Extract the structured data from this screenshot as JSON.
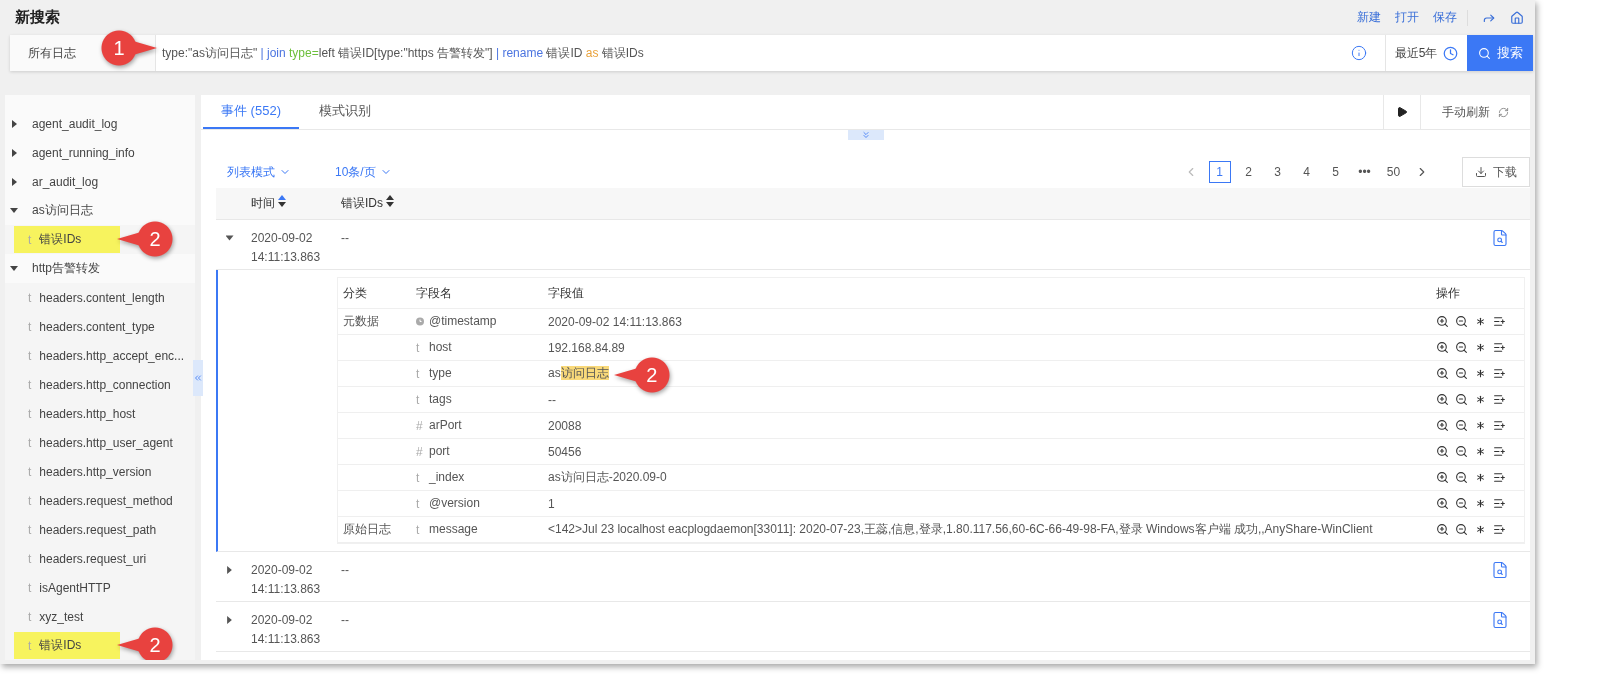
{
  "header": {
    "title": "新搜索",
    "actions": [
      "新建",
      "打开",
      "保存"
    ]
  },
  "search": {
    "scope": "所有日志",
    "callout": "1",
    "query": [
      {
        "text": "type:\"as访问日志\" ",
        "kind": "plain"
      },
      {
        "text": "| join",
        "kind": "keyword"
      },
      {
        "text": " type=",
        "kind": "param"
      },
      {
        "text": "left 错误ID[type:\"https 告警转发\"] ",
        "kind": "plain"
      },
      {
        "text": "| rename",
        "kind": "keyword"
      },
      {
        "text": " 错误ID ",
        "kind": "plain"
      },
      {
        "text": "as",
        "kind": "operator"
      },
      {
        "text": " 错误IDs",
        "kind": "plain"
      }
    ],
    "time_range": "最近5年",
    "button": "搜索"
  },
  "sidebar": {
    "items": [
      {
        "label": "agent_audit_log",
        "expanded": false
      },
      {
        "label": "agent_running_info",
        "expanded": false
      },
      {
        "label": "ar_audit_log",
        "expanded": false
      },
      {
        "label": "as访问日志",
        "expanded": true,
        "children": [
          {
            "glyph": "t",
            "label": "错误IDs",
            "highlighted": true,
            "callout": "2"
          }
        ]
      },
      {
        "label": "http告警转发",
        "expanded": true,
        "children": [
          {
            "glyph": "t",
            "label": "headers.content_length",
            "highlighted": false
          },
          {
            "glyph": "t",
            "label": "headers.content_type",
            "highlighted": false
          },
          {
            "glyph": "t",
            "label": "headers.http_accept_enc...",
            "highlighted": false
          },
          {
            "glyph": "t",
            "label": "headers.http_connection",
            "highlighted": false
          },
          {
            "glyph": "t",
            "label": "headers.http_host",
            "highlighted": false
          },
          {
            "glyph": "t",
            "label": "headers.http_user_agent",
            "highlighted": false
          },
          {
            "glyph": "t",
            "label": "headers.http_version",
            "highlighted": false
          },
          {
            "glyph": "t",
            "label": "headers.request_method",
            "highlighted": false
          },
          {
            "glyph": "t",
            "label": "headers.request_path",
            "highlighted": false
          },
          {
            "glyph": "t",
            "label": "headers.request_uri",
            "highlighted": false
          },
          {
            "glyph": "t",
            "label": "isAgentHTTP",
            "highlighted": false
          },
          {
            "glyph": "t",
            "label": "xyz_test",
            "highlighted": false
          },
          {
            "glyph": "t",
            "label": "错误IDs",
            "highlighted": true,
            "callout": "2"
          }
        ]
      }
    ]
  },
  "tabs": [
    {
      "label": "事件 (552)",
      "selected": true
    },
    {
      "label": "模式识别",
      "selected": false
    }
  ],
  "refresh": "手动刷新",
  "toolbar": {
    "view_mode": "列表模式",
    "page_size": "10条/页",
    "download": "下载"
  },
  "pagination": [
    {
      "label": "1",
      "selected": true
    },
    {
      "label": "2",
      "selected": false
    },
    {
      "label": "3",
      "selected": false
    },
    {
      "label": "4",
      "selected": false
    },
    {
      "label": "5",
      "selected": false
    },
    {
      "label": "•••",
      "selected": false
    },
    {
      "label": "50",
      "selected": false
    }
  ],
  "table": {
    "columns": [
      "时间",
      "错误IDs"
    ],
    "rows": [
      {
        "time": "2020-09-02 14:11:13.863",
        "error_ids": "--",
        "expanded": true,
        "detail": {
          "columns": [
            "分类",
            "字段名",
            "字段值",
            "操作"
          ],
          "fields": [
            {
              "category": "元数据",
              "kind": "date",
              "name": "@timestamp",
              "value": "2020-09-02 14:11:13.863"
            },
            {
              "kind": "text",
              "glyph": "t",
              "name": "host",
              "value": "192.168.84.89"
            },
            {
              "kind": "text",
              "glyph": "t",
              "name": "type",
              "value": "as",
              "value_highlight": "访问日志",
              "callout": "2"
            },
            {
              "kind": "text",
              "glyph": "t",
              "name": "tags",
              "value": "--"
            },
            {
              "kind": "number",
              "glyph": "#",
              "name": "arPort",
              "value": "20088"
            },
            {
              "kind": "number",
              "glyph": "#",
              "name": "port",
              "value": "50456"
            },
            {
              "kind": "text",
              "glyph": "t",
              "name": "_index",
              "value": "as访问日志-2020.09-0"
            },
            {
              "kind": "text",
              "glyph": "t",
              "name": "@version",
              "value": "1"
            },
            {
              "category": "原始日志",
              "kind": "text",
              "glyph": "t",
              "name": "message",
              "value": "<142>Jul 23 localhost eacplogdaemon[33011]: 2020-07-23,王蕊,信息,登录,1.80.117.56,60-6C-66-49-98-FA,登录 Windows客户端 成功,,AnyShare-WinClient"
            }
          ]
        }
      },
      {
        "time": "2020-09-02 14:11:13.863",
        "error_ids": "--",
        "expanded": false
      },
      {
        "time": "2020-09-02 14:11:13.863",
        "error_ids": "--",
        "expanded": false
      }
    ]
  }
}
